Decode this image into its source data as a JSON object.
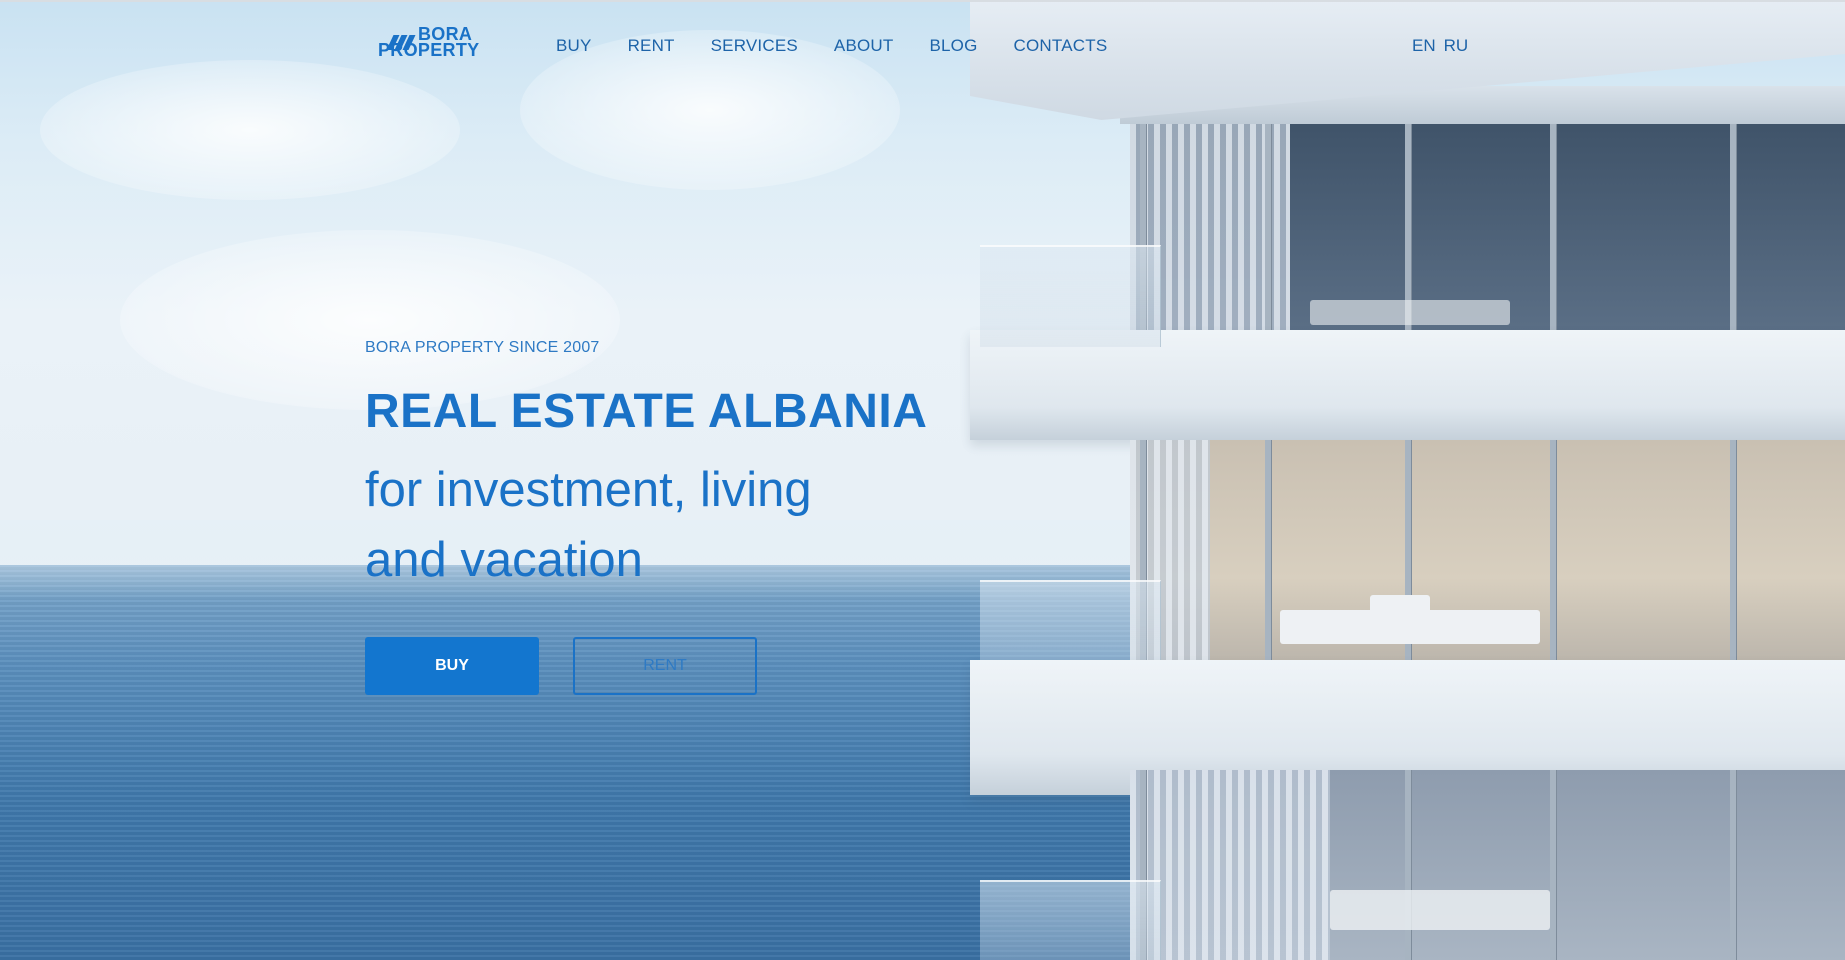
{
  "header": {
    "logo": {
      "line1": "BORA",
      "line2": "PROPERTY"
    },
    "nav": [
      {
        "label": "BUY"
      },
      {
        "label": "RENT"
      },
      {
        "label": "SERVICES"
      },
      {
        "label": "ABOUT"
      },
      {
        "label": "BLOG"
      },
      {
        "label": "CONTACTS"
      }
    ],
    "languages": [
      {
        "label": "EN"
      },
      {
        "label": "RU"
      }
    ]
  },
  "hero": {
    "since": "BORA PROPERTY SINCE 2007",
    "headline": "REAL ESTATE ALBANIA",
    "subline_1": "for investment, living",
    "subline_2": "and vacation",
    "buy_button": "BUY",
    "rent_button": "RENT"
  },
  "colors": {
    "brand_blue": "#1a72c7",
    "button_blue": "#1376cf",
    "nav_text": "#1d63a8"
  }
}
